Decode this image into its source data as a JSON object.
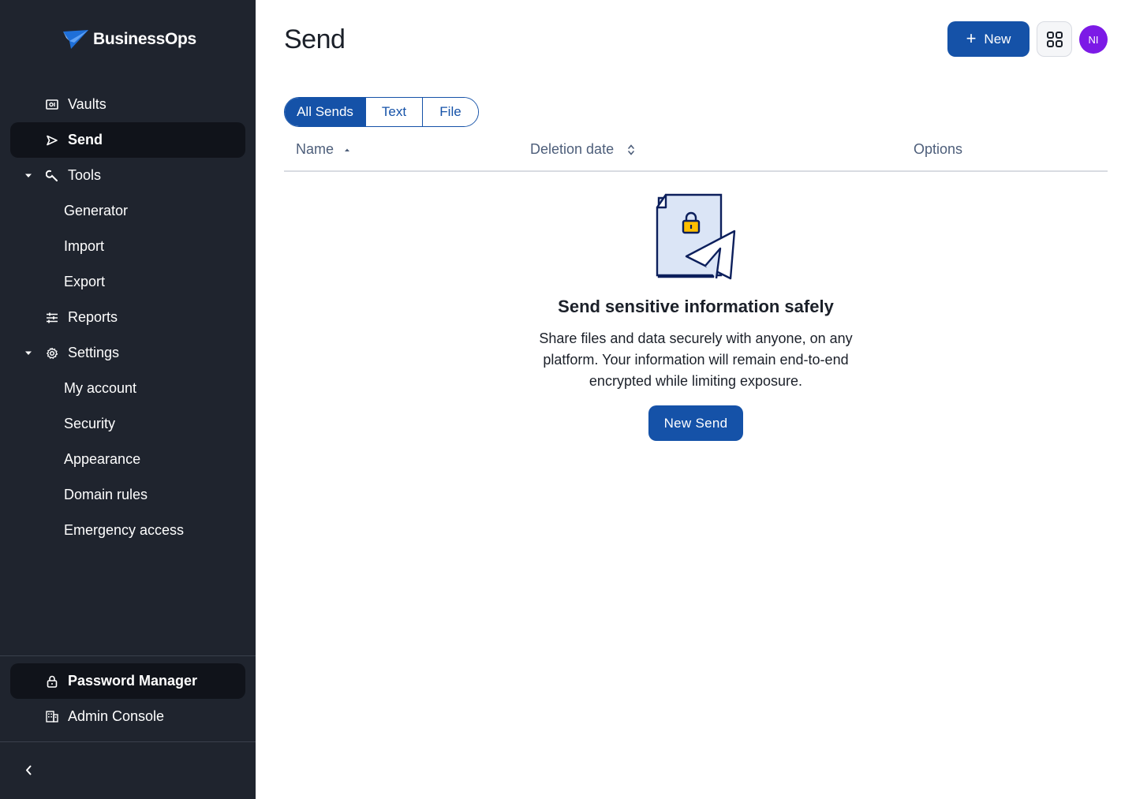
{
  "brand": {
    "name": "BusinessOps"
  },
  "sidebar": {
    "items": [
      {
        "label": "Vaults",
        "icon": "vault-icon"
      },
      {
        "label": "Send",
        "icon": "send-icon",
        "active": true
      },
      {
        "label": "Tools",
        "icon": "wrench-icon",
        "expanded": true
      },
      {
        "label": "Generator"
      },
      {
        "label": "Import"
      },
      {
        "label": "Export"
      },
      {
        "label": "Reports",
        "icon": "sliders-icon"
      },
      {
        "label": "Settings",
        "icon": "gear-icon",
        "expanded": true
      },
      {
        "label": "My account"
      },
      {
        "label": "Security"
      },
      {
        "label": "Appearance"
      },
      {
        "label": "Domain rules"
      },
      {
        "label": "Emergency access"
      }
    ],
    "products": [
      {
        "label": "Password Manager",
        "icon": "lock-icon",
        "active": true
      },
      {
        "label": "Admin Console",
        "icon": "building-icon"
      }
    ],
    "collapse_icon": "chevron-left-icon"
  },
  "header": {
    "title": "Send",
    "new_button_label": "New",
    "avatar_initials": "NI"
  },
  "filters": {
    "tabs": [
      "All Sends",
      "Text",
      "File"
    ],
    "selected": "All Sends"
  },
  "table": {
    "columns": [
      "Name",
      "Deletion date",
      "Options"
    ],
    "rows": []
  },
  "empty_state": {
    "title": "Send sensitive information safely",
    "description": "Share files and data securely with anyone, on any platform. Your information will remain end-to-end encrypted while limiting exposure.",
    "button_label": "New Send"
  },
  "colors": {
    "sidebar_bg": "#1f242e",
    "primary": "#1552a8",
    "avatar": "#7c1ae6",
    "muted_text": "#4d5e7a"
  }
}
